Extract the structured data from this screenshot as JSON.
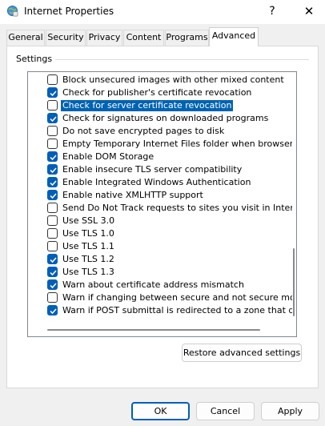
{
  "window": {
    "title": "Internet Properties",
    "help_glyph": "?",
    "close_glyph": "✕"
  },
  "tabs": [
    {
      "label": "General"
    },
    {
      "label": "Security"
    },
    {
      "label": "Privacy"
    },
    {
      "label": "Content"
    },
    {
      "label": "Programs"
    },
    {
      "label": "Advanced",
      "active": true
    }
  ],
  "settings": {
    "group_label": "Settings",
    "items": [
      {
        "label": "Block unsecured images with other mixed content",
        "checked": false
      },
      {
        "label": "Check for publisher's certificate revocation",
        "checked": true
      },
      {
        "label": "Check for server certificate revocation",
        "checked": false,
        "selected": true
      },
      {
        "label": "Check for signatures on downloaded programs",
        "checked": true
      },
      {
        "label": "Do not save encrypted pages to disk",
        "checked": false
      },
      {
        "label": "Empty Temporary Internet Files folder when browser is clo",
        "checked": false
      },
      {
        "label": "Enable DOM Storage",
        "checked": true
      },
      {
        "label": "Enable insecure TLS server compatibility",
        "checked": true
      },
      {
        "label": "Enable Integrated Windows Authentication",
        "checked": true
      },
      {
        "label": "Enable native XMLHTTP support",
        "checked": true
      },
      {
        "label": "Send Do Not Track requests to sites you visit in Internet E",
        "checked": false
      },
      {
        "label": "Use SSL 3.0",
        "checked": false
      },
      {
        "label": "Use TLS 1.0",
        "checked": false
      },
      {
        "label": "Use TLS 1.1",
        "checked": false
      },
      {
        "label": "Use TLS 1.2",
        "checked": true
      },
      {
        "label": "Use TLS 1.3",
        "checked": true
      },
      {
        "label": "Warn about certificate address mismatch",
        "checked": true
      },
      {
        "label": "Warn if changing between secure and not secure mode",
        "checked": false
      },
      {
        "label": "Warn if POST submittal is redirected to a zone that does n",
        "checked": true
      }
    ]
  },
  "buttons": {
    "restore": "Restore advanced settings",
    "ok": "OK",
    "cancel": "Cancel",
    "apply": "Apply"
  },
  "colors": {
    "accent": "#005fb8",
    "selection": "#0063b1"
  }
}
